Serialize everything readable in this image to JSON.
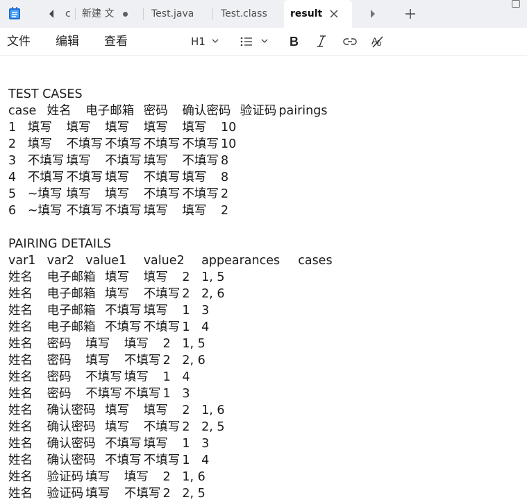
{
  "tabs": [
    {
      "label": "c"
    },
    {
      "label": "新建 文"
    },
    {
      "label": "Test.java"
    },
    {
      "label": "Test.class"
    },
    {
      "label": "result",
      "active": true
    }
  ],
  "menu": {
    "file": "文件",
    "edit": "编辑",
    "view": "查看",
    "heading": "H1"
  },
  "icons": {
    "app": "notepad-icon",
    "back": "chevron-left-icon",
    "forward": "chevron-right-icon",
    "new_tab": "plus-icon",
    "bold": "bold-icon",
    "italic": "italic-icon",
    "link": "link-icon",
    "clear_format": "clear-format-icon",
    "list": "bulleted-list-icon"
  },
  "document": {
    "lines": [
      "",
      "TEST CASES",
      "case\t姓名\t电子邮箱\t密码\t确认密码\t验证码\tpairings",
      "1\t填写\t填写\t填写\t填写\t填写\t10",
      "2\t填写\t不填写\t不填写\t不填写\t不填写\t10",
      "3\t不填写\t填写\t不填写\t填写\t不填写\t8",
      "4\t不填写\t不填写\t填写\t不填写\t填写\t8",
      "5\t~填写\t填写\t填写\t不填写\t不填写\t2",
      "6\t~填写\t不填写\t不填写\t填写\t填写\t2",
      "",
      "PAIRING DETAILS",
      "var1\tvar2\tvalue1\tvalue2\tappearances\tcases",
      "姓名\t电子邮箱\t填写\t填写\t2\t1, 5",
      "姓名\t电子邮箱\t填写\t不填写\t2\t2, 6",
      "姓名\t电子邮箱\t不填写\t填写\t1\t3",
      "姓名\t电子邮箱\t不填写\t不填写\t1\t4",
      "姓名\t密码\t填写\t填写\t2\t1, 5",
      "姓名\t密码\t填写\t不填写\t2\t2, 6",
      "姓名\t密码\t不填写\t填写\t1\t4",
      "姓名\t密码\t不填写\t不填写\t1\t3",
      "姓名\t确认密码\t填写\t填写\t2\t1, 6",
      "姓名\t确认密码\t填写\t不填写\t2\t2, 5",
      "姓名\t确认密码\t不填写\t填写\t1\t3",
      "姓名\t确认密码\t不填写\t不填写\t1\t4",
      "姓名\t验证码\t填写\t填写\t2\t1, 6",
      "姓名\t验证码\t填写\t不填写\t2\t2, 5"
    ]
  }
}
